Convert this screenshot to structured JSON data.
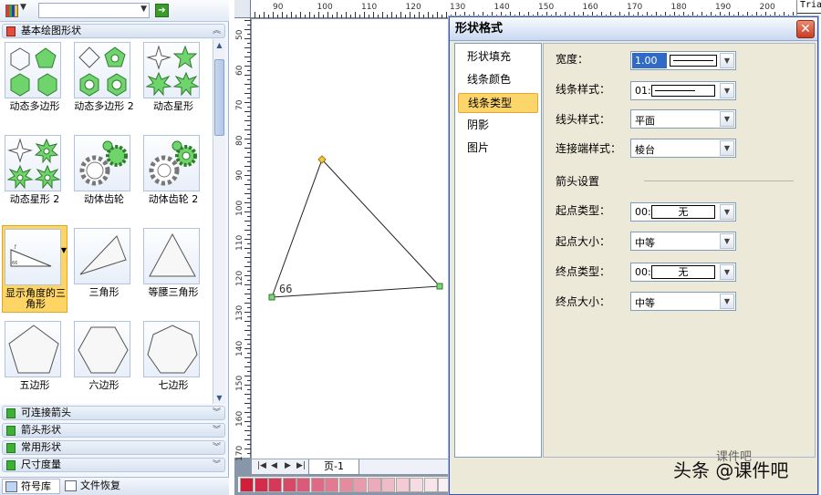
{
  "left_panel": {
    "toolbar": {
      "combo_value": "",
      "dropdown_glyph": "▼",
      "go_glyph": "➔"
    },
    "sections_top": [
      {
        "label": "基本绘图形状"
      }
    ],
    "shapes": [
      {
        "name": "动态多边形"
      },
      {
        "name": "动态多边形 2"
      },
      {
        "name": "动态星形"
      },
      {
        "name": "动态星形 2"
      },
      {
        "name": "动体齿轮"
      },
      {
        "name": "动体齿轮 2"
      },
      {
        "name": "显示角度的三角形"
      },
      {
        "name": "三角形"
      },
      {
        "name": "等腰三角形"
      },
      {
        "name": "五边形"
      },
      {
        "name": "六边形"
      },
      {
        "name": "七边形"
      }
    ],
    "sections_bottom": [
      {
        "label": "可连接箭头"
      },
      {
        "label": "箭头形状"
      },
      {
        "label": "常用形状"
      },
      {
        "label": "尺寸度量"
      }
    ],
    "bottom_tabs": [
      {
        "label": "符号库"
      },
      {
        "label": "文件恢复"
      }
    ]
  },
  "canvas": {
    "ruler_h": [
      "90",
      "100",
      "110",
      "120",
      "130",
      "140",
      "150",
      "160",
      "170",
      "180",
      "190",
      "200"
    ],
    "ruler_v": [
      "50",
      "60",
      "70",
      "80",
      "90",
      "100",
      "110",
      "120",
      "130",
      "140",
      "150",
      "160",
      "170"
    ],
    "angle_label": "66",
    "page_tab": "页-1",
    "nav": [
      "|◀",
      "◀",
      "▶",
      "▶|"
    ]
  },
  "right_strip": {
    "text": "Tria"
  },
  "dialog": {
    "title": "形状格式",
    "close_glyph": "✕",
    "categories": [
      {
        "label": "形状填充",
        "selected": false
      },
      {
        "label": "线条颜色",
        "selected": false
      },
      {
        "label": "线条类型",
        "selected": true
      },
      {
        "label": "阴影",
        "selected": false
      },
      {
        "label": "图片",
        "selected": false
      }
    ],
    "fields": {
      "width_label": "宽度：",
      "width_value": "1.00",
      "line_style_label": "线条样式：",
      "line_style_value": "01:",
      "cap_label": "线头样式：",
      "cap_value": "平面",
      "join_label": "连接端样式：",
      "join_value": "棱台",
      "arrow_heading": "箭头设置",
      "start_type_label": "起点类型：",
      "start_type_prefix": "00:",
      "start_type_value": "无",
      "start_size_label": "起点大小：",
      "start_size_value": "中等",
      "end_type_label": "终点类型：",
      "end_type_prefix": "00:",
      "end_type_value": "无",
      "end_size_label": "终点大小：",
      "end_size_value": "中等"
    }
  },
  "watermark": {
    "text": "头条 @课件吧",
    "sub": "课件吧"
  },
  "colors": {
    "accent": "#fcd66b",
    "title_bar": "#c8d8f2",
    "close": "#c63d22"
  }
}
